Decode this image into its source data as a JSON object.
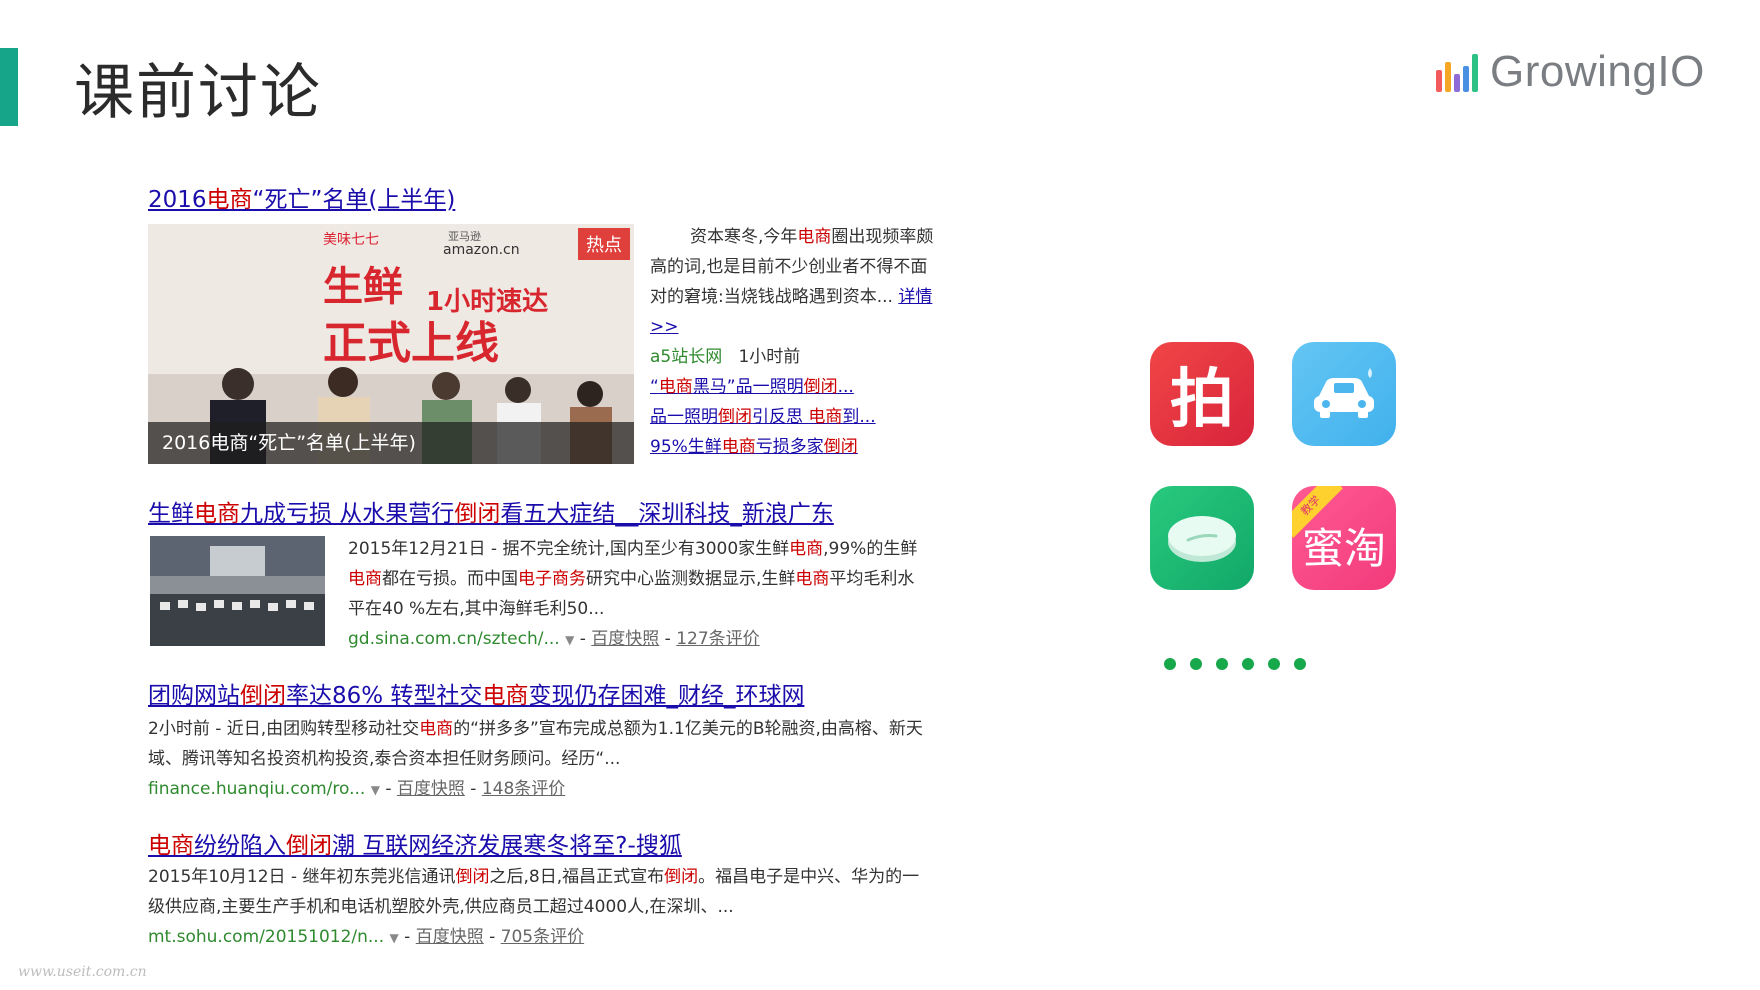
{
  "slide": {
    "title": "课前讨论"
  },
  "logo": {
    "text": "GrowingIO",
    "bar_colors": [
      "#f15b5b",
      "#f5a623",
      "#8e6bd6",
      "#4a90e2",
      "#2cc185"
    ]
  },
  "result1": {
    "title_a": "2016",
    "title_b": "电商",
    "title_c": "“死亡”名单(上半年)",
    "badge": "热点",
    "image_caption": "2016电商“死亡”名单(上半年)",
    "image_text": {
      "brand1": "美味七七",
      "brand2a": "亚马逊",
      "brand2b": "amazon.cn",
      "big1": "生鲜",
      "big2": "1小时速达",
      "big3": "正式上线"
    },
    "summary_a": "资本寒冬,今年",
    "summary_b": "电商",
    "summary_c": "圈出现频率颇高的词,也是目前不少创业者不得不面对的窘境:当烧钱战略遇到资本... ",
    "detail_link": "详情>>",
    "source": "a5站长网",
    "time": "1小时前",
    "related": [
      {
        "a": "“",
        "b": "电商",
        "c": "黑马”品一照明",
        "d": "倒闭",
        "e": "..."
      },
      {
        "a": "品一照明",
        "b": "倒闭",
        "c": "引反思 ",
        "d": "电商",
        "e": "到..."
      },
      {
        "a": "95%生鲜",
        "b": "电商",
        "c": "亏损多家",
        "d": "倒闭",
        "e": ""
      }
    ]
  },
  "result2": {
    "title_a": "生鲜",
    "title_b": "电商",
    "title_c": "九成亏损 从水果营行",
    "title_d": "倒闭",
    "title_e": "看五大症结__深圳科技_新浪广东",
    "date": "2015年12月21日",
    "s1": " - 据不完全统计,国内至少有3000家生鲜",
    "s2": "电商",
    "s3": ",99%的生鲜",
    "s4": "电商",
    "s5": "都在亏损。而中国",
    "s6": "电子商务",
    "s7": "研究中心监测数据显示,生鲜",
    "s8": "电商",
    "s9": "平均毛利水平在40 %左右,其中海鲜毛利50...",
    "url": "gd.sina.com.cn/sztech/...",
    "cache": "百度快照",
    "comments": "127条评价"
  },
  "result3": {
    "title_a": "团购网站",
    "title_b": "倒闭",
    "title_c": "率达86% 转型社交",
    "title_d": "电商",
    "title_e": "变现仍存困难_财经_环球网",
    "date": "2小时前",
    "s1": " - 近日,由团购转型移动社交",
    "s2": "电商",
    "s3": "的“拼多多”宣布完成总额为1.1亿美元的B轮融资,由高榕、新天域、腾讯等知名投资机构投资,泰合资本担任财务顾问。经历“...",
    "url": "finance.huanqiu.com/ro...",
    "cache": "百度快照",
    "comments": "148条评价"
  },
  "result4": {
    "title_a": "电商",
    "title_b": "纷纷陷入",
    "title_c": "倒闭",
    "title_d": "潮 互联网经济发展寒冬将至?-搜狐",
    "date": "2015年10月12日",
    "s1": " - 继年初东莞兆信通讯",
    "s2": "倒闭",
    "s3": "之后,8日,福昌正式宣布",
    "s4": "倒闭",
    "s5": "。福昌电子是中兴、华为的一级供应商,主要生产手机和电话机塑胶外壳,供应商员工超过4000人,在深圳、...",
    "url": "mt.sohu.com/20151012/n...",
    "cache": "百度快照",
    "comments": "705条评价"
  },
  "apps": {
    "pai_char": "拍",
    "mitao_ribbon": "教学",
    "mitao_label": "蜜淘",
    "ellipsis_count": 6
  },
  "watermark": "www.useit.com.cn"
}
